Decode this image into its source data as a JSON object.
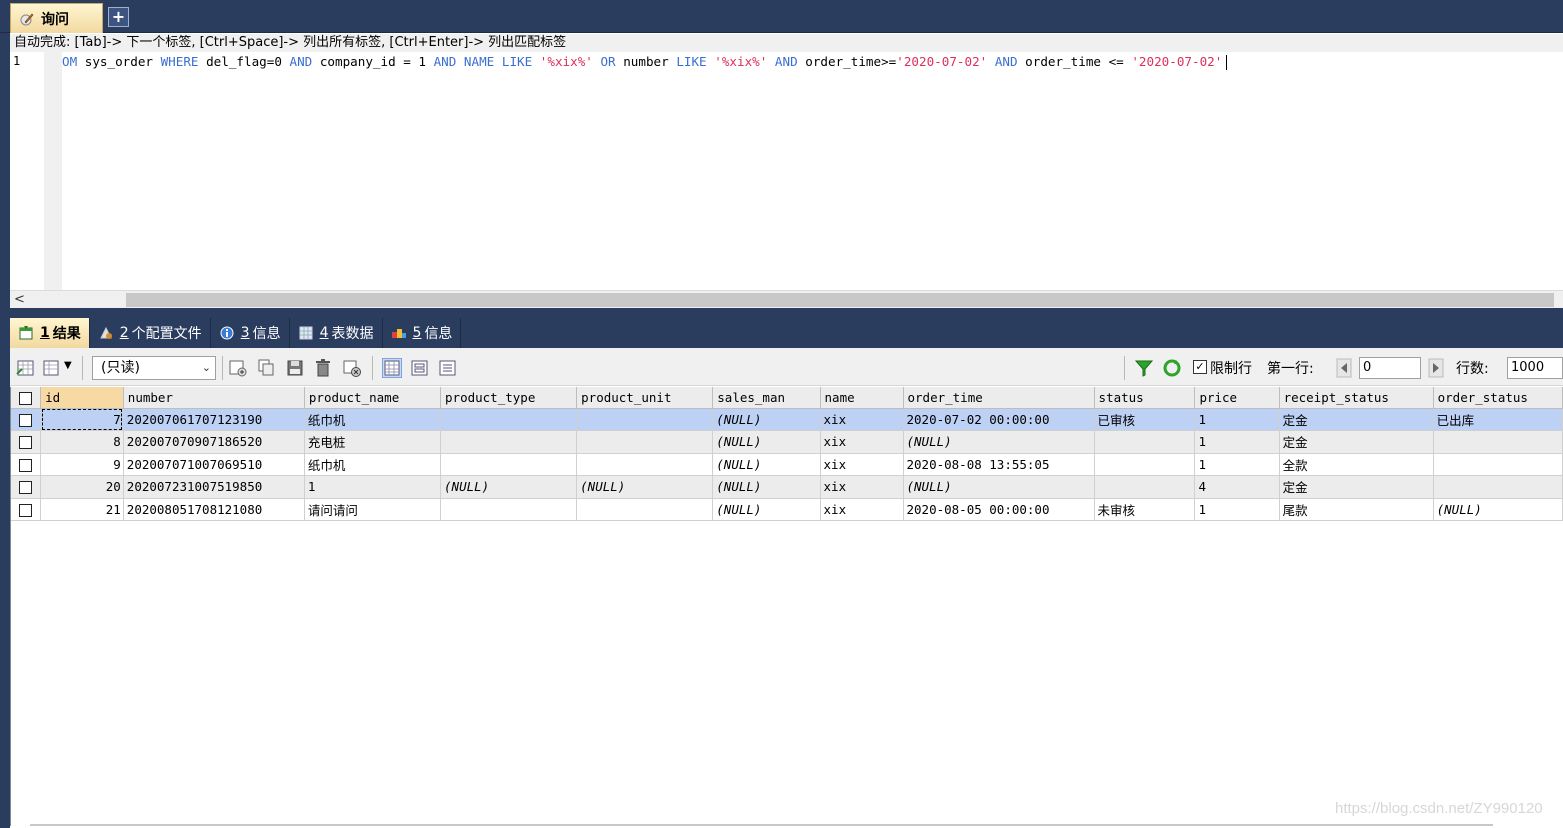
{
  "query_tab": {
    "label": "询问",
    "add_label": "+"
  },
  "hint": "自动完成: [Tab]-> 下一个标签, [Ctrl+Space]-> 列出所有标签, [Ctrl+Enter]-> 列出匹配标签",
  "editor": {
    "line_number": "1",
    "sql": {
      "p1": "OM",
      "p2": " sys_order ",
      "p3": "WHERE",
      "p4": " del_flag=0 ",
      "p5": "AND",
      "p6": " company_id = 1 ",
      "p7": "AND",
      "p8": " ",
      "p9": "NAME",
      "p10": " ",
      "p11": "LIKE",
      "p12": " ",
      "p13": "'%xix%'",
      "p14": " ",
      "p15": "OR",
      "p16": " number ",
      "p17": "LIKE",
      "p18": " ",
      "p19": "'%xix%'",
      "p20": " ",
      "p21": "AND",
      "p22": " order_time>=",
      "p23": "'2020-07-02'",
      "p24": " ",
      "p25": "AND",
      "p26": " order_time <= ",
      "p27": "'2020-07-02'"
    }
  },
  "scrollbar": {
    "left_arrow": "<"
  },
  "result_tabs": [
    {
      "num": "1",
      "label": "结果"
    },
    {
      "num": "2",
      "label": "个配置文件"
    },
    {
      "num": "3",
      "label": "信息"
    },
    {
      "num": "4",
      "label": "表数据"
    },
    {
      "num": "5",
      "label": "信息"
    }
  ],
  "toolbar": {
    "mode_select": "(只读)",
    "limit_rows_label": "限制行",
    "first_row_label": "第一行:",
    "first_row_value": "0",
    "row_count_label": "行数:",
    "row_count_value": "1000",
    "limit_checked": "✓"
  },
  "grid": {
    "columns": [
      "id",
      "number",
      "product_name",
      "product_type",
      "product_unit",
      "sales_man",
      "name",
      "order_time",
      "status",
      "price",
      "receipt_status",
      "order_status"
    ],
    "rows": [
      [
        "7",
        "202007061707123190",
        "纸巾机",
        "",
        "",
        "(NULL)",
        "xix",
        "2020-07-02 00:00:00",
        "已审核",
        "1",
        "定金",
        "已出库"
      ],
      [
        "8",
        "202007070907186520",
        "充电桩",
        "",
        "",
        "(NULL)",
        "xix",
        "(NULL)",
        "",
        "1",
        "定金",
        ""
      ],
      [
        "9",
        "202007071007069510",
        "纸巾机",
        "",
        "",
        "(NULL)",
        "xix",
        "2020-08-08 13:55:05",
        "",
        "1",
        "全款",
        ""
      ],
      [
        "20",
        "202007231007519850",
        "1",
        "(NULL)",
        "(NULL)",
        "(NULL)",
        "xix",
        "(NULL)",
        "",
        "4",
        "定金",
        ""
      ],
      [
        "21",
        "202008051708121080",
        "请问请问",
        "",
        "",
        "(NULL)",
        "xix",
        "2020-08-05 00:00:00",
        "未审核",
        "1",
        "尾款",
        "(NULL)"
      ]
    ]
  },
  "watermark": "https://blog.csdn.net/ZY990120",
  "colors": {
    "frame": "#2b3d5f",
    "keyword": "#3b6ed2",
    "string": "#e0305a",
    "selected_row": "#bdd1f5"
  }
}
